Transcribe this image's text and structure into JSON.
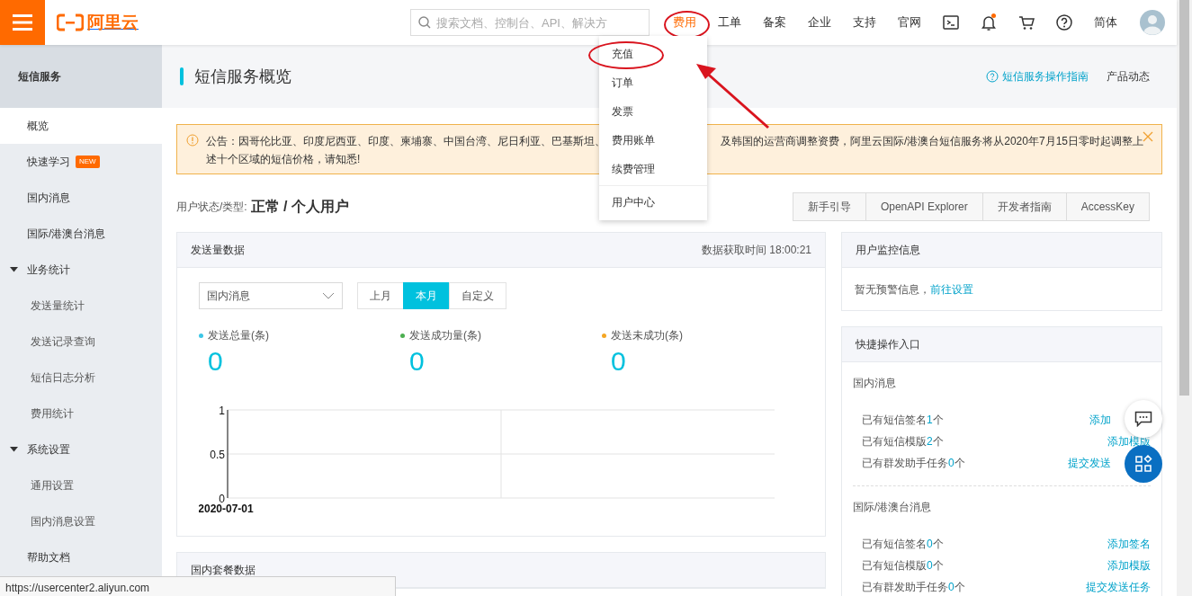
{
  "topbar": {
    "logo": "阿里云",
    "search": {
      "placeholder": "搜索文档、控制台、API、解决方"
    },
    "nav": [
      {
        "label": "费用",
        "active": true,
        "circled": true
      },
      {
        "label": "工单",
        "active": false,
        "circled": false
      },
      {
        "label": "备案",
        "active": false,
        "circled": false
      },
      {
        "label": "企业",
        "active": false,
        "circled": false
      },
      {
        "label": "支持",
        "active": false,
        "circled": false
      },
      {
        "label": "官网",
        "active": false,
        "circled": false
      }
    ],
    "tools": [
      {
        "kind": "terminal",
        "unread": false
      },
      {
        "kind": "bell",
        "unread": true
      },
      {
        "kind": "cart",
        "unread": false
      },
      {
        "kind": "help",
        "unread": false
      }
    ],
    "language": "简体"
  },
  "dropdown": {
    "items": [
      {
        "label": "充值",
        "circled": true
      },
      {
        "label": "订单",
        "circled": false
      },
      {
        "label": "发票",
        "circled": false
      },
      {
        "label": "费用账单",
        "circled": false
      },
      {
        "label": "续费管理",
        "circled": false
      }
    ],
    "footer_items": [
      {
        "label": "用户中心",
        "circled": false
      }
    ]
  },
  "annotations": {
    "arrow": true
  },
  "sidebar": {
    "title": "短信服务",
    "items": [
      {
        "label": "概览",
        "selected": true
      },
      {
        "label": "快速学习",
        "selected": false,
        "badge": "NEW"
      },
      {
        "label": "国内消息",
        "selected": false
      },
      {
        "label": "国际/港澳台消息",
        "selected": false
      },
      {
        "label": "业务统计",
        "selected": false,
        "expanded": true,
        "children": [
          {
            "label": "发送量统计",
            "selected": false
          },
          {
            "label": "发送记录查询",
            "selected": false
          },
          {
            "label": "短信日志分析",
            "selected": false
          },
          {
            "label": "费用统计",
            "selected": false
          }
        ]
      },
      {
        "label": "系统设置",
        "selected": false,
        "expanded": true,
        "children": [
          {
            "label": "通用设置",
            "selected": false
          },
          {
            "label": "国内消息设置",
            "selected": false
          }
        ]
      },
      {
        "label": "帮助文档",
        "selected": false
      }
    ]
  },
  "page_header": {
    "title": "短信服务概览",
    "guide_link": "短信服务操作指南",
    "news_link": "产品动态"
  },
  "notice": {
    "line_1_start": "公告：因哥伦比亚、印度尼西亚、印度、柬埔寨、中国台湾、尼日利亚、巴基斯坦、",
    "line_1_end": "及韩国的运营商调整资费，阿里云国际/港澳台短信服务将从2020年7月15日零时起调整上",
    "line_2": "述十个区域的短信价格，请知悉!"
  },
  "user_status": {
    "label": "用户状态/类型:",
    "value": "正常 / 个人用户"
  },
  "quick_buttons": [
    "新手引导",
    "OpenAPI Explorer",
    "开发者指南",
    "AccessKey"
  ],
  "send_card": {
    "title": "发送量数据",
    "fetch_time": "数据获取时间 18:00:21",
    "select": {
      "value": "国内消息"
    },
    "periods": [
      {
        "label": "上月",
        "selected": false
      },
      {
        "label": "本月",
        "selected": true
      },
      {
        "label": "自定义",
        "selected": false
      }
    ],
    "stats": [
      {
        "label": "发送总量(条)",
        "value": "0",
        "color": "#3cc6e6"
      },
      {
        "label": "发送成功量(条)",
        "value": "0",
        "color": "#4caf50"
      },
      {
        "label": "发送未成功(条)",
        "value": "0",
        "color": "#f5a623"
      }
    ],
    "chart_data": {
      "type": "line",
      "categories": [
        "2020-07-01"
      ],
      "ylim": [
        0,
        1
      ],
      "yticks": [
        0,
        0.5,
        1
      ],
      "grid": true
    }
  },
  "package_card": {
    "title": "国内套餐数据"
  },
  "monitor_card": {
    "title": "用户监控信息",
    "text": "暂无预警信息，",
    "link": "前往设置"
  },
  "shortcut_card": {
    "title": "快捷操作入口",
    "sections": [
      {
        "title": "国内消息",
        "rows": [
          {
            "before": "已有短信签名",
            "count": "1",
            "after": "个",
            "action": "添加",
            "covered": true
          },
          {
            "before": "已有短信模版",
            "count": "2",
            "after": "个",
            "action": "添加模版",
            "covered": false
          },
          {
            "before": "已有群发助手任务",
            "count": "0",
            "after": "个",
            "action": "提交发送",
            "covered": true
          }
        ]
      },
      {
        "title": "国际/港澳台消息",
        "rows": [
          {
            "before": "已有短信签名",
            "count": "0",
            "after": "个",
            "action": "添加签名"
          },
          {
            "before": "已有短信模版",
            "count": "0",
            "after": "个",
            "action": "添加模版"
          },
          {
            "before": "已有群发助手任务",
            "count": "0",
            "after": "个",
            "action": "提交发送任务"
          }
        ]
      }
    ]
  },
  "status_url": "https://usercenter2.aliyun.com"
}
